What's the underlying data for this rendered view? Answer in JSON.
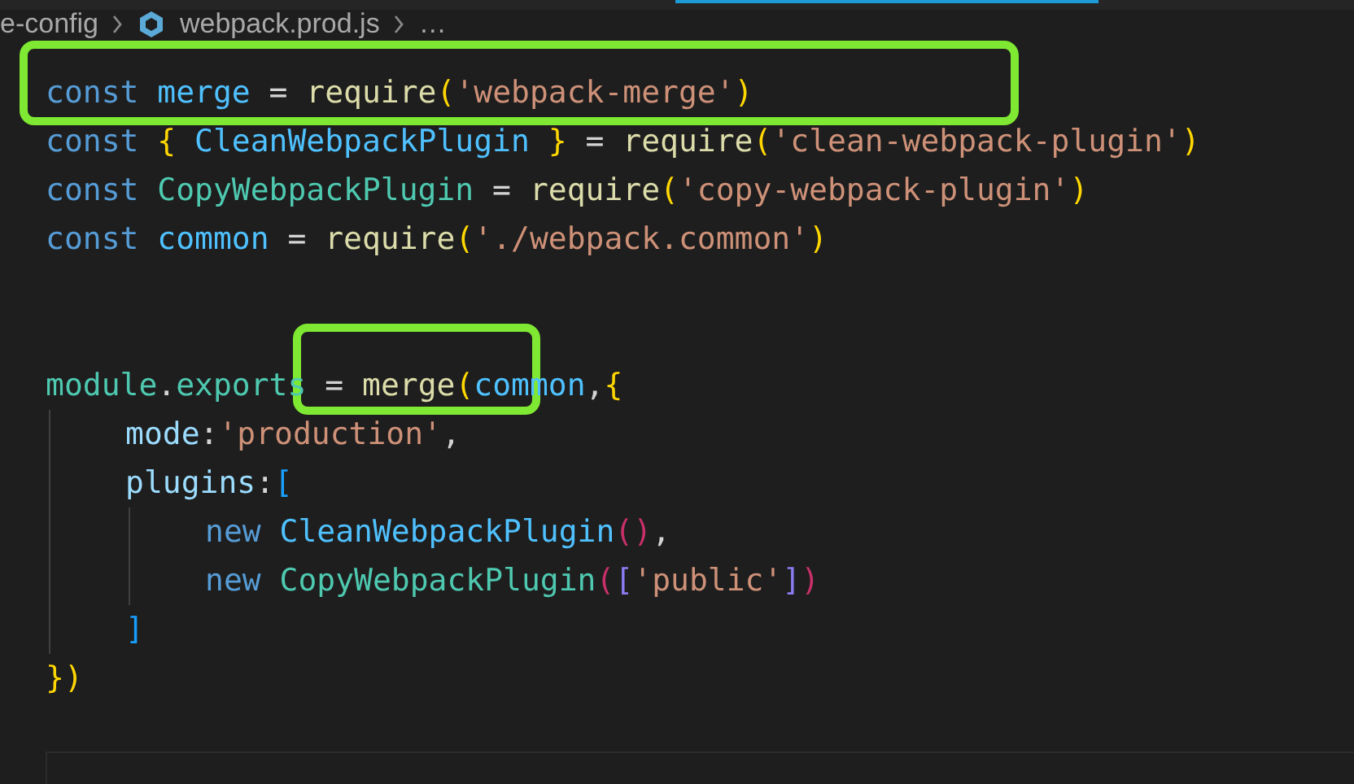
{
  "tab_bar": {
    "active_indicator": true
  },
  "breadcrumb": [
    {
      "text": "e-config",
      "kind": "folder"
    },
    {
      "text": "webpack.prod.js",
      "kind": "file"
    },
    {
      "text": "…",
      "kind": "more"
    }
  ],
  "code": [
    {
      "tokens": [
        {
          "text": "const ",
          "kind": "keyword"
        },
        {
          "text": "merge",
          "kind": "constant"
        },
        {
          "text": " = "
        },
        {
          "text": "require",
          "kind": "function"
        },
        {
          "text": "(",
          "kind": "bracket1"
        },
        {
          "text": "'webpack-merge'",
          "kind": "string"
        },
        {
          "text": ")",
          "kind": "bracket1"
        }
      ]
    },
    {
      "tokens": [
        {
          "text": "const ",
          "kind": "keyword"
        },
        {
          "text": "{ ",
          "kind": "bracket1"
        },
        {
          "text": "CleanWebpackPlugin ",
          "kind": "constant"
        },
        {
          "text": "}",
          "kind": "bracket1"
        },
        {
          "text": " = "
        },
        {
          "text": "require",
          "kind": "function"
        },
        {
          "text": "(",
          "kind": "bracket1"
        },
        {
          "text": "'clean-webpack-plugin'",
          "kind": "string"
        },
        {
          "text": ")",
          "kind": "bracket1"
        }
      ]
    },
    {
      "tokens": [
        {
          "text": "const ",
          "kind": "keyword"
        },
        {
          "text": "CopyWebpackPlugin",
          "kind": "class"
        },
        {
          "text": " = "
        },
        {
          "text": "require",
          "kind": "function"
        },
        {
          "text": "(",
          "kind": "bracket1"
        },
        {
          "text": "'copy-webpack-plugin'",
          "kind": "string"
        },
        {
          "text": ")",
          "kind": "bracket1"
        }
      ]
    },
    {
      "tokens": [
        {
          "text": "const ",
          "kind": "keyword"
        },
        {
          "text": "common",
          "kind": "constant"
        },
        {
          "text": " = "
        },
        {
          "text": "require",
          "kind": "function"
        },
        {
          "text": "(",
          "kind": "bracket1"
        },
        {
          "text": "'./webpack.common'",
          "kind": "string"
        },
        {
          "text": ")",
          "kind": "bracket1"
        }
      ]
    },
    {
      "kind": "blank"
    },
    {
      "kind": "blank"
    },
    {
      "tokens": [
        {
          "text": "module",
          "kind": "class"
        },
        {
          "text": "."
        },
        {
          "text": "exports",
          "kind": "class"
        },
        {
          "text": " = "
        },
        {
          "text": "merge",
          "kind": "function"
        },
        {
          "text": "(",
          "kind": "bracket1"
        },
        {
          "text": "common",
          "kind": "constant"
        },
        {
          "text": ","
        },
        {
          "text": "{",
          "kind": "bracket2"
        }
      ],
      "children": [
        {
          "tokens": [
            {
              "text": "mode",
              "kind": "property"
            },
            {
              "text": ":"
            },
            {
              "text": "'production'",
              "kind": "string"
            },
            {
              "text": ","
            }
          ]
        },
        {
          "tokens": [
            {
              "text": "plugins",
              "kind": "property"
            },
            {
              "text": ":"
            },
            {
              "text": "[",
              "kind": "bracket3"
            }
          ],
          "children": [
            {
              "tokens": [
                {
                  "text": "new ",
                  "kind": "keyword"
                },
                {
                  "text": "CleanWebpackPlugin",
                  "kind": "constant"
                },
                {
                  "text": "()",
                  "kind": "bracket4"
                },
                {
                  "text": ","
                }
              ]
            },
            {
              "tokens": [
                {
                  "text": "new ",
                  "kind": "keyword"
                },
                {
                  "text": "CopyWebpackPlugin",
                  "kind": "class"
                },
                {
                  "text": "(",
                  "kind": "bracket4"
                },
                {
                  "text": "[",
                  "kind": "bracket5"
                },
                {
                  "text": "'public'",
                  "kind": "string"
                },
                {
                  "text": "]",
                  "kind": "bracket5"
                },
                {
                  "text": ")",
                  "kind": "bracket4"
                }
              ]
            }
          ]
        },
        {
          "tokens": [
            {
              "text": "]",
              "kind": "bracket3"
            }
          ]
        }
      ]
    },
    {
      "tokens": [
        {
          "text": "}",
          "kind": "bracket2"
        },
        {
          "text": ")",
          "kind": "bracket1"
        }
      ]
    }
  ],
  "annotations": [
    {
      "kind": "frame",
      "color": "#7ee833"
    },
    {
      "kind": "frame",
      "color": "#7ee833"
    }
  ]
}
